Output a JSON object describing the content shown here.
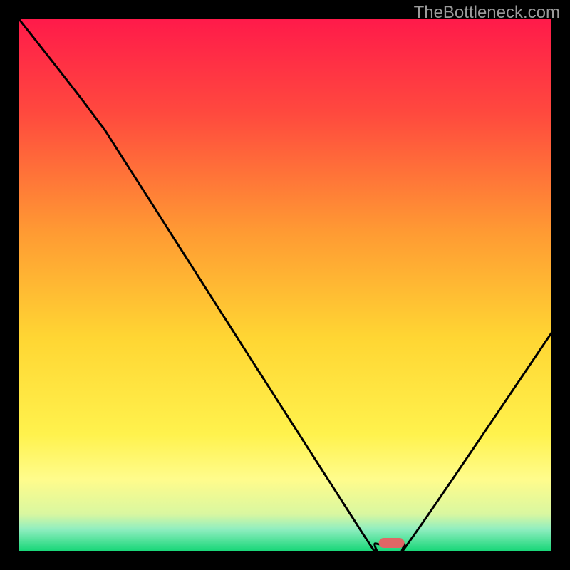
{
  "watermark_text": "TheBottleneck.com",
  "chart_data": {
    "type": "line",
    "title": "",
    "xlabel": "",
    "ylabel": "",
    "x_range": [
      0,
      100
    ],
    "y_range": [
      0,
      100
    ],
    "curve": [
      {
        "x": 0.0,
        "y": 100.0
      },
      {
        "x": 14.0,
        "y": 82.0
      },
      {
        "x": 22.0,
        "y": 70.0
      },
      {
        "x": 64.5,
        "y": 3.5
      },
      {
        "x": 67.0,
        "y": 1.5
      },
      {
        "x": 72.0,
        "y": 1.5
      },
      {
        "x": 74.5,
        "y": 3.5
      },
      {
        "x": 100.0,
        "y": 41.0
      }
    ],
    "marker": {
      "x": 70.0,
      "y": 1.6,
      "color": "#e06666"
    },
    "gradient_stops": [
      {
        "offset": 0,
        "color": "#ff1a4a"
      },
      {
        "offset": 0.18,
        "color": "#ff4a3e"
      },
      {
        "offset": 0.4,
        "color": "#ff9a33"
      },
      {
        "offset": 0.6,
        "color": "#ffd633"
      },
      {
        "offset": 0.78,
        "color": "#fff24d"
      },
      {
        "offset": 0.865,
        "color": "#fffc8c"
      },
      {
        "offset": 0.93,
        "color": "#d9f7a0"
      },
      {
        "offset": 0.958,
        "color": "#90eec0"
      },
      {
        "offset": 1.0,
        "color": "#15d676"
      }
    ],
    "frame_color": "#000000",
    "frame_width": 26
  }
}
